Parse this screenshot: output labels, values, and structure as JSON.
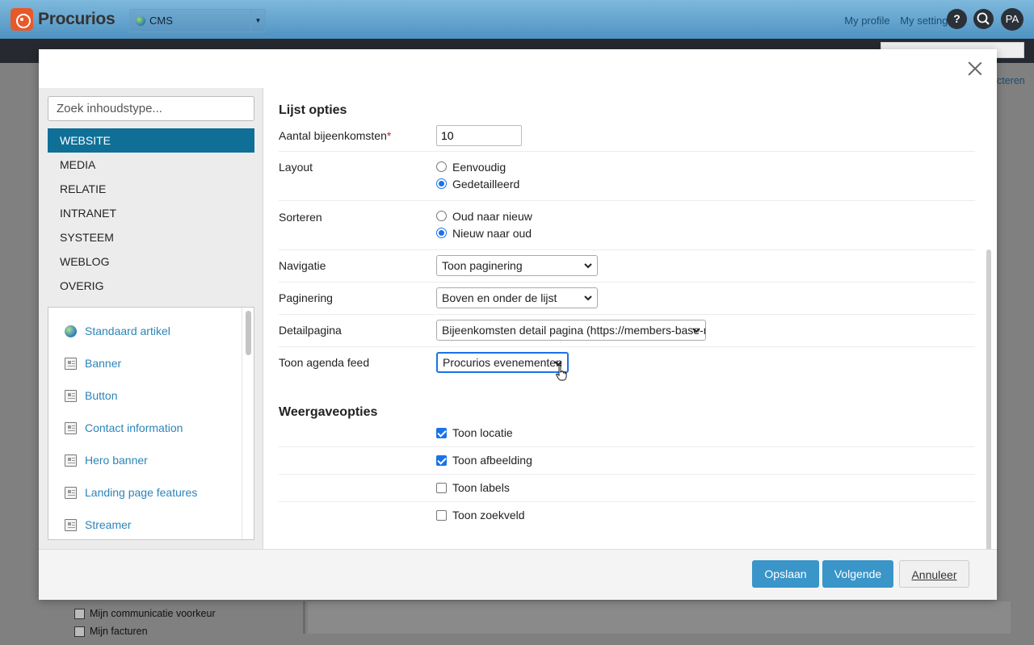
{
  "app": {
    "logo_text": "Procurios",
    "cms_selector": "CMS",
    "top_links": [
      "My profile",
      "My settings"
    ],
    "help_label": "?",
    "avatar_initials": "PA",
    "background_right_fragment": "cteren",
    "background_tree_items": [
      "Mijn communicatie voorkeur",
      "Mijn facturen"
    ]
  },
  "modal": {
    "search": {
      "placeholder": "Zoek inhoudstype...",
      "value": ""
    },
    "categories": [
      {
        "label": "WEBSITE",
        "active": true
      },
      {
        "label": "MEDIA",
        "active": false
      },
      {
        "label": "RELATIE",
        "active": false
      },
      {
        "label": "INTRANET",
        "active": false
      },
      {
        "label": "SYSTEEM",
        "active": false
      },
      {
        "label": "WEBLOG",
        "active": false
      },
      {
        "label": "OVERIG",
        "active": false
      }
    ],
    "content_types": [
      {
        "label": "Standaard artikel",
        "icon": "globe-icon"
      },
      {
        "label": "Banner",
        "icon": "document-icon"
      },
      {
        "label": "Button",
        "icon": "document-icon"
      },
      {
        "label": "Contact information",
        "icon": "document-icon"
      },
      {
        "label": "Hero banner",
        "icon": "document-icon"
      },
      {
        "label": "Landing page features",
        "icon": "document-icon"
      },
      {
        "label": "Streamer",
        "icon": "document-icon"
      }
    ],
    "list_options": {
      "title": "Lijst opties",
      "aantal": {
        "label": "Aantal bijeenkomsten",
        "required_mark": "*",
        "value": "10"
      },
      "layout": {
        "label": "Layout",
        "options": [
          "Eenvoudig",
          "Gedetailleerd"
        ],
        "selected": "Gedetailleerd"
      },
      "sorteren": {
        "label": "Sorteren",
        "options": [
          "Oud naar nieuw",
          "Nieuw naar oud"
        ],
        "selected": "Nieuw naar oud"
      },
      "navigatie": {
        "label": "Navigatie",
        "value": "Toon paginering"
      },
      "paginering": {
        "label": "Paginering",
        "value": "Boven en onder de lijst"
      },
      "detailpagina": {
        "label": "Detailpagina",
        "value": "Bijeenkomsten detail pagina (https://members-base-n"
      },
      "agenda_feed": {
        "label": "Toon agenda feed",
        "value": "Procurios evenementen"
      }
    },
    "display_options": {
      "title": "Weergaveopties",
      "checkboxes": [
        {
          "label": "Toon locatie",
          "checked": true
        },
        {
          "label": "Toon afbeelding",
          "checked": true
        },
        {
          "label": "Toon labels",
          "checked": false
        },
        {
          "label": "Toon zoekveld",
          "checked": false
        }
      ]
    },
    "buttons": {
      "save": "Opslaan",
      "next": "Volgende",
      "cancel": "Annuleer"
    }
  },
  "colors": {
    "accent": "#0f6f97",
    "button_primary": "#3a95c9",
    "link": "#2c84b8",
    "required": "#d01b1b"
  }
}
